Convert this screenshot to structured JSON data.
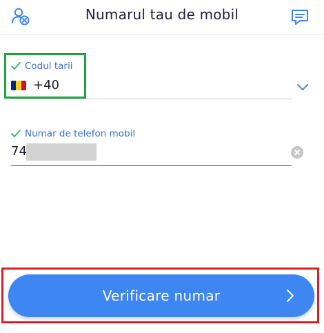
{
  "header": {
    "title": "Numarul tau de mobil",
    "left_icon": "user-remove-icon",
    "right_icon": "chat-icon"
  },
  "country_field": {
    "label": "Codul tarii",
    "value": "+40",
    "flag": "romania-flag",
    "colors": {
      "blue": "#002B7F",
      "yellow": "#FCD116",
      "red": "#CE1126"
    }
  },
  "phone_field": {
    "label": "Numar de telefon mobil",
    "value_visible": "74"
  },
  "submit": {
    "label": "Verificare numar"
  },
  "colors": {
    "accent": "#3e86f2",
    "label": "#3a6fd0",
    "check": "#2fbf71",
    "title": "#22233d"
  }
}
